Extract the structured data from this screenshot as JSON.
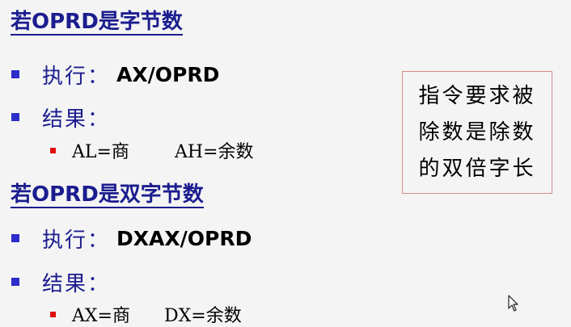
{
  "section1": {
    "heading_prefix": "若",
    "heading_code": "OPRD",
    "heading_suffix": "是字节数",
    "exec_label": "执行：",
    "exec_code": "AX/OPRD",
    "result_label": "结果：",
    "result_quotient": "AL=商",
    "result_remainder": "AH=余数"
  },
  "section2": {
    "heading_prefix": "若",
    "heading_code": "OPRD",
    "heading_suffix": "是双字节数",
    "exec_label": "执行：",
    "exec_code": "DXAX/OPRD",
    "result_label": "结果：",
    "result_quotient": "AX=商",
    "result_remainder": "DX=余数"
  },
  "note": {
    "line1": "指令要求被",
    "line2": "除数是除数",
    "line3": "的双倍字长"
  },
  "colors": {
    "heading": "#1b1d8f",
    "bullet": "#2b2ec8",
    "sub_bullet": "#e01010",
    "note_border": "#d88a8a"
  },
  "icons": [
    "mouse-pointer-icon"
  ]
}
